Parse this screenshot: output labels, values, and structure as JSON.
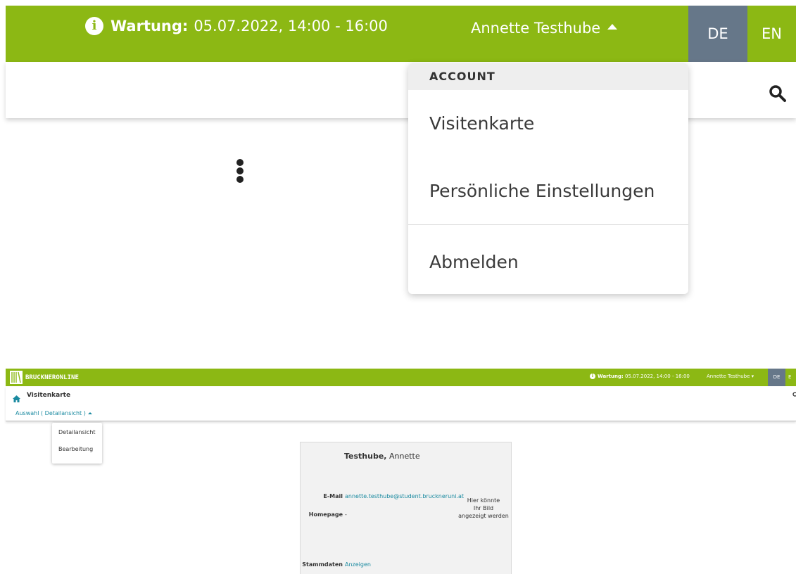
{
  "zoom": {
    "maintenance": {
      "label": "Wartung:",
      "text": "05.07.2022, 14:00 - 16:00"
    },
    "user_name": "Annette Testhube",
    "languages": {
      "de": "DE",
      "en": "EN"
    },
    "account_menu": {
      "header": "ACCOUNT",
      "items": [
        "Visitenkarte",
        "Persönliche Einstellungen",
        "Abmelden"
      ]
    }
  },
  "mini": {
    "logo_text": "BRUCKNERONLINE",
    "maintenance": {
      "label": "Wartung:",
      "text": "05.07.2022, 14:00 - 16:00"
    },
    "user_name": "Annette Testhube",
    "languages": {
      "de": "DE",
      "en": "E"
    },
    "page_title": "Visitenkarte",
    "view_select": "Auswahl ( Detailansicht )",
    "view_options": [
      "Detailansicht",
      "Bearbeitung"
    ],
    "card": {
      "last_name": "Testhube,",
      "first_name": "Annette",
      "email_label": "E-Mail",
      "email_value": "annette.testhube@student.bruckneruni.at",
      "homepage_label": "Homepage",
      "homepage_value": "-",
      "photo_line1": "Hier könnte",
      "photo_line2": "Ihr Bild",
      "photo_line3": "angezeigt werden",
      "stammdaten_label": "Stammdaten",
      "stammdaten_link": "Anzeigen"
    }
  },
  "colors": {
    "brand_green": "#8cb814",
    "lang_active": "#667789",
    "link": "#1a8aa0"
  }
}
